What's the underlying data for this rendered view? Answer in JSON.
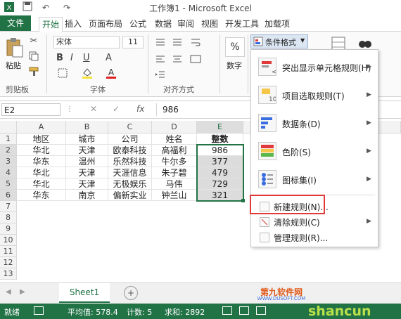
{
  "window": {
    "title": "工作簿1 - Microsoft Excel"
  },
  "tabs": [
    "文件",
    "开始",
    "插入",
    "页面布局",
    "公式",
    "数据",
    "审阅",
    "视图",
    "开发工具",
    "加载项"
  ],
  "ribbon": {
    "paste": "粘贴",
    "font_name": "宋体",
    "font_size": "11",
    "percent": "%",
    "number": "数字",
    "cond_format": "条件格式",
    "groups": {
      "clipboard": "剪贴板",
      "font": "字体",
      "alignment": "对齐方式"
    }
  },
  "formula_bar": {
    "name_box": "E2",
    "cancel": "✕",
    "enter": "✓",
    "fx": "fx",
    "value": "986"
  },
  "columns": [
    "A",
    "B",
    "C",
    "D",
    "E"
  ],
  "rows": [
    "1",
    "2",
    "3",
    "4",
    "5",
    "6",
    "7",
    "8",
    "9",
    "10",
    "11",
    "12",
    "13"
  ],
  "table": {
    "header": [
      "地区",
      "城市",
      "公司",
      "姓名",
      "整数"
    ],
    "data": [
      [
        "华北",
        "天津",
        "欧泰科技",
        "高福利",
        "986"
      ],
      [
        "华东",
        "温州",
        "乐然科技",
        "牛尔多",
        "377"
      ],
      [
        "华北",
        "天津",
        "天涯信息",
        "朱子碧",
        "479"
      ],
      [
        "华北",
        "天津",
        "无极娱乐",
        "马伟",
        "729"
      ],
      [
        "华东",
        "南京",
        "偏新实业",
        "钟兰山",
        "321"
      ]
    ]
  },
  "menu": {
    "items": [
      "突出显示单元格规则(H)",
      "项目选取规则(T)",
      "数据条(D)",
      "色阶(S)",
      "图标集(I)"
    ],
    "small_items": [
      "新建规则(N)...",
      "清除规则(C)",
      "管理规则(R)..."
    ],
    "highlight_color": "#e03a3a"
  },
  "sheets": {
    "active": "Sheet1",
    "add": "+"
  },
  "status": {
    "ready": "就绪",
    "average": "平均值: 578.4",
    "count": "计数: 5",
    "sum": "求和: 2892"
  },
  "watermark": {
    "site": "WWW.DUSOFT.COM",
    "brand": "shancun"
  },
  "colors": {
    "accent": "#217346",
    "selection": "#dcdcdc"
  }
}
